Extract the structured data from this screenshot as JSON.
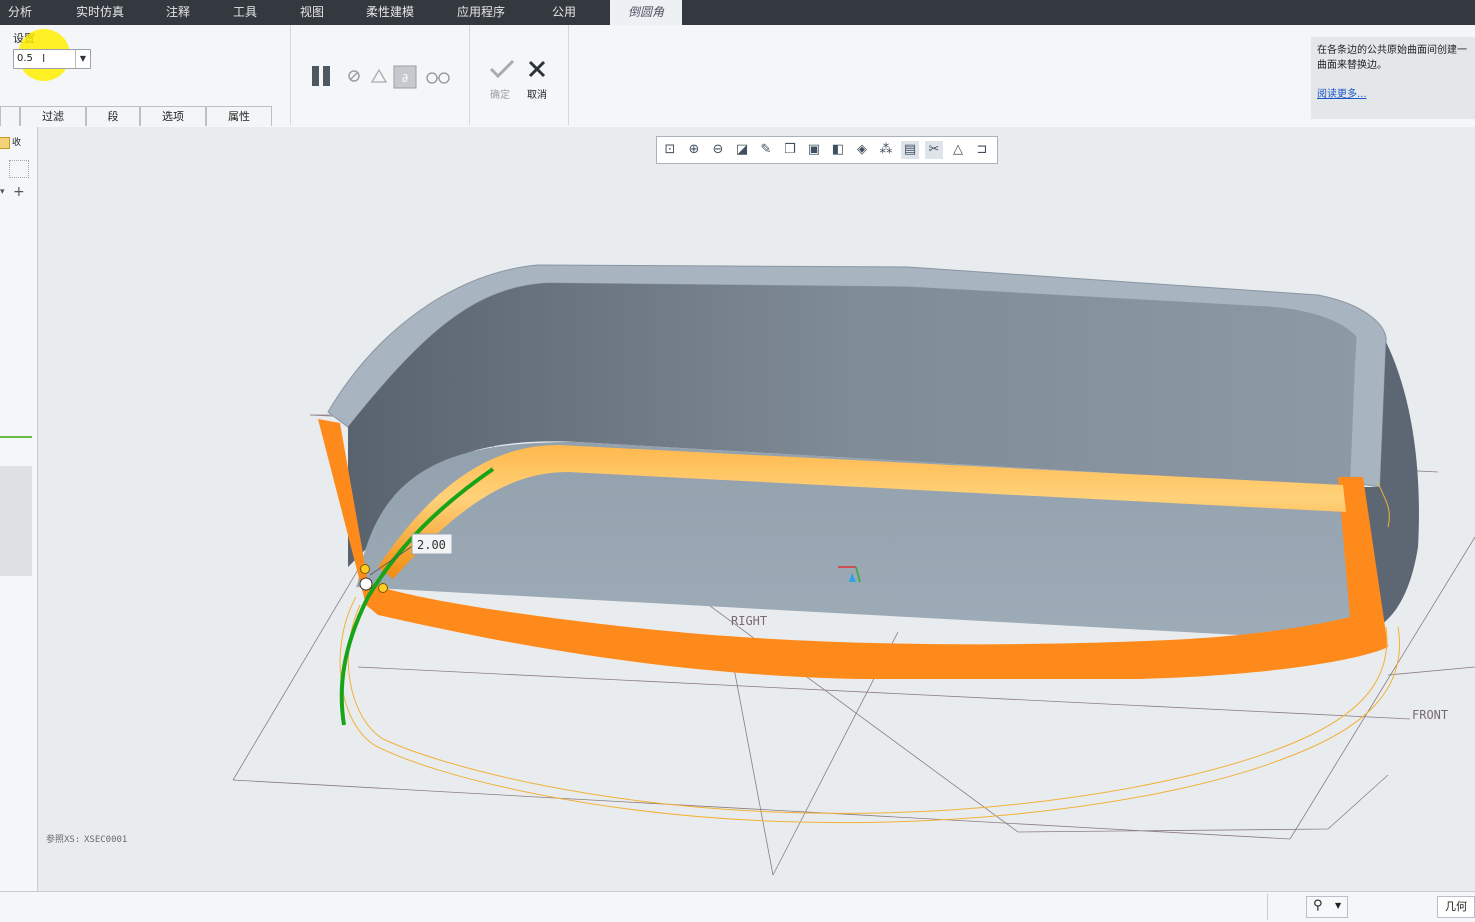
{
  "menu": {
    "items": [
      "分析",
      "实时仿真",
      "注释",
      "工具",
      "视图",
      "柔性建模",
      "应用程序",
      "公用"
    ],
    "active_tab": "倒圆角"
  },
  "settings": {
    "label": "设置",
    "value": "0.5"
  },
  "tabs": [
    "过滤",
    "段",
    "选项",
    "属性"
  ],
  "actions": {
    "ok": "确定",
    "cancel": "取消"
  },
  "help": {
    "text": "在各条边的公共原始曲面间创建一曲面来替换边。",
    "link": "阅读更多..."
  },
  "leftpane": {
    "collapse_label": "收"
  },
  "viewport": {
    "dimension_value": "2.00",
    "plane_right": "RIGHT",
    "plane_front": "FRONT",
    "xsec_label": "XSEC0001",
    "xsec_prefix": "参照XS:"
  },
  "status": {
    "geometry_filter": "几何"
  },
  "colors": {
    "menubar": "#33393e",
    "round_highlight": "#ff8c1a",
    "chain_green": "#1aa31a",
    "model_fill": "#7e8d9c"
  },
  "icons": [
    "pause-icon",
    "stop-icon",
    "preview-icon",
    "glasses-icon",
    "check-icon",
    "x-icon",
    "zoom-fit-icon",
    "zoom-in-icon",
    "zoom-out-icon",
    "binoculars-icon"
  ]
}
